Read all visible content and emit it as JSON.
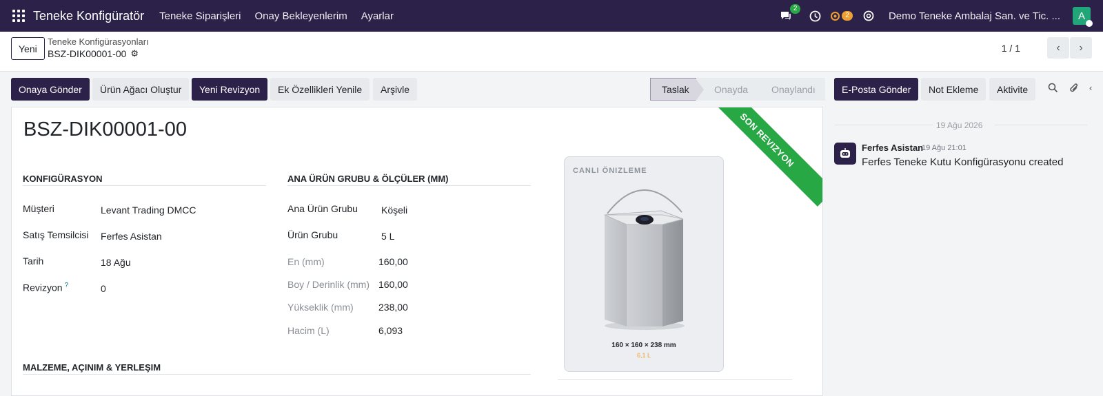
{
  "navbar": {
    "app_title": "Teneke Konfigüratör",
    "menu": [
      "Teneke Siparişleri",
      "Onay Bekleyenlerim",
      "Ayarlar"
    ],
    "messages_count": "2",
    "activities_count": "2",
    "company": "Demo Teneke Ambalaj San. ve Tic. ...",
    "avatar_letter": "A"
  },
  "control": {
    "new_label": "Yeni",
    "breadcrumb": "Teneke Konfigürasyonları",
    "record": "BSZ-DIK00001-00",
    "pager": "1 / 1"
  },
  "actions": [
    "Onaya Gönder",
    "Ürün Ağacı Oluştur",
    "Yeni Revizyon",
    "Ek Özellikleri Yenile",
    "Arşivle"
  ],
  "status": {
    "stages": [
      "Taslak",
      "Onayda",
      "Onaylandı"
    ],
    "current": "Taslak"
  },
  "form": {
    "title": "BSZ-DIK00001-00",
    "ribbon": "SON REVIZYON",
    "config": {
      "heading": "KONFIGÜRASYON",
      "fields": [
        {
          "label": "Müşteri",
          "value": "Levant Trading DMCC"
        },
        {
          "label": "Satış Temsilcisi",
          "value": "Ferfes Asistan"
        },
        {
          "label": "Tarih",
          "value": "18 Ağu"
        },
        {
          "label": "Revizyon",
          "value": "0",
          "help": "?"
        }
      ]
    },
    "product": {
      "heading": "ANA ÜRÜN GRUBU & ÖLÇÜLER (MM)",
      "fields": [
        {
          "label": "Ana Ürün Grubu",
          "value": "Köşeli"
        },
        {
          "label": "Ürün Grubu",
          "value": "5 L"
        },
        {
          "label": "En (mm)",
          "value": "160,00"
        },
        {
          "label": "Boy / Derinlik (mm)",
          "value": "160,00"
        },
        {
          "label": "Yükseklik (mm)",
          "value": "238,00"
        },
        {
          "label": "Hacim (L)",
          "value": "6,093"
        }
      ]
    },
    "material_heading": "MALZEME, AÇINIM & YERLEŞIM",
    "preview": {
      "title": "CANLI ÖNIZLEME",
      "dims": "160 × 160 × 238 mm",
      "volume": "6,1 L"
    }
  },
  "chatter": {
    "buttons": [
      "E-Posta Gönder",
      "Not Ekleme",
      "Aktivite"
    ],
    "date": "19 Ağu 2026",
    "author": "Ferfes Asistan",
    "time": "19 Ağu 21:01",
    "message": "Ferfes Teneke Kutu Konfigürasyonu created"
  },
  "colors": {
    "navbar": "#2c2148",
    "primary": "#2c2148",
    "ribbon": "#28a745",
    "badge": "#28a745",
    "accent_orange": "#f0a030"
  }
}
